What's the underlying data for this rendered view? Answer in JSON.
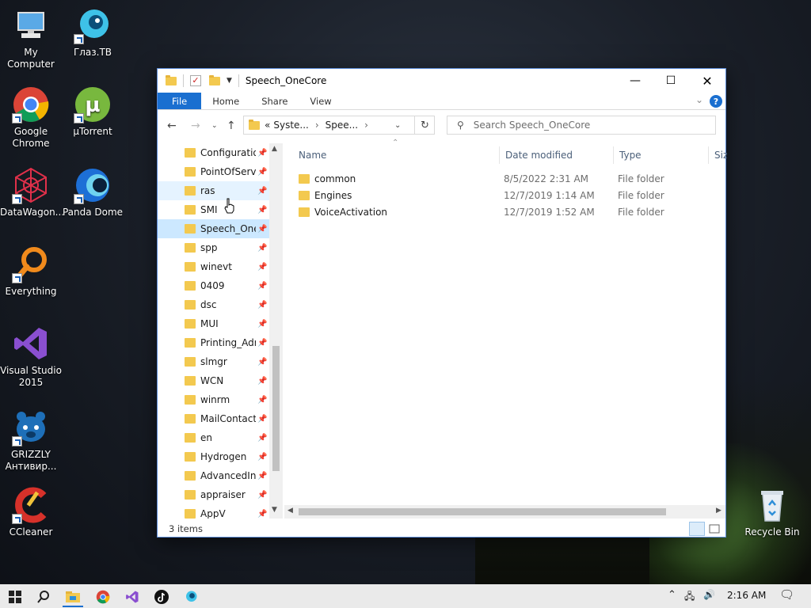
{
  "desktop": {
    "icons": [
      {
        "label": "My Computer"
      },
      {
        "label": "Глаз.ТВ"
      },
      {
        "label": "Google Chrome"
      },
      {
        "label": "µTorrent"
      },
      {
        "label": "DataWagon..."
      },
      {
        "label": "Panda Dome"
      },
      {
        "label": "Everything"
      },
      {
        "label": "Visual Studio 2015"
      },
      {
        "label": "GRIZZLY Антивир..."
      },
      {
        "label": "CCleaner"
      },
      {
        "label": "Recycle Bin"
      }
    ]
  },
  "window": {
    "title": "Speech_OneCore",
    "ribbon_tabs": [
      "File",
      "Home",
      "Share",
      "View"
    ],
    "help_label": "?",
    "address": {
      "prefix": "«",
      "segments": [
        "Syste...",
        "Spee..."
      ]
    },
    "search_placeholder": "Search Speech_OneCore",
    "nav_items": [
      "Configuration",
      "PointOfService",
      "ras",
      "SMI",
      "Speech_OneCore",
      "spp",
      "winevt",
      "0409",
      "dsc",
      "MUI",
      "Printing_Admin",
      "slmgr",
      "WCN",
      "winrm",
      "MailContacts",
      "en",
      "Hydrogen",
      "AdvancedInstallers",
      "appraiser",
      "AppV"
    ],
    "columns": [
      "Name",
      "Date modified",
      "Type",
      "Size"
    ],
    "files": [
      {
        "name": "common",
        "date": "8/5/2022 2:31 AM",
        "type": "File folder"
      },
      {
        "name": "Engines",
        "date": "12/7/2019 1:14 AM",
        "type": "File folder"
      },
      {
        "name": "VoiceActivation",
        "date": "12/7/2019 1:52 AM",
        "type": "File folder"
      }
    ],
    "status": "3 items"
  },
  "taskbar": {
    "time": "2:16 AM"
  },
  "colors": {
    "accent": "#1a6fd0",
    "folder": "#f3c94f",
    "selection": "#cce8ff"
  }
}
